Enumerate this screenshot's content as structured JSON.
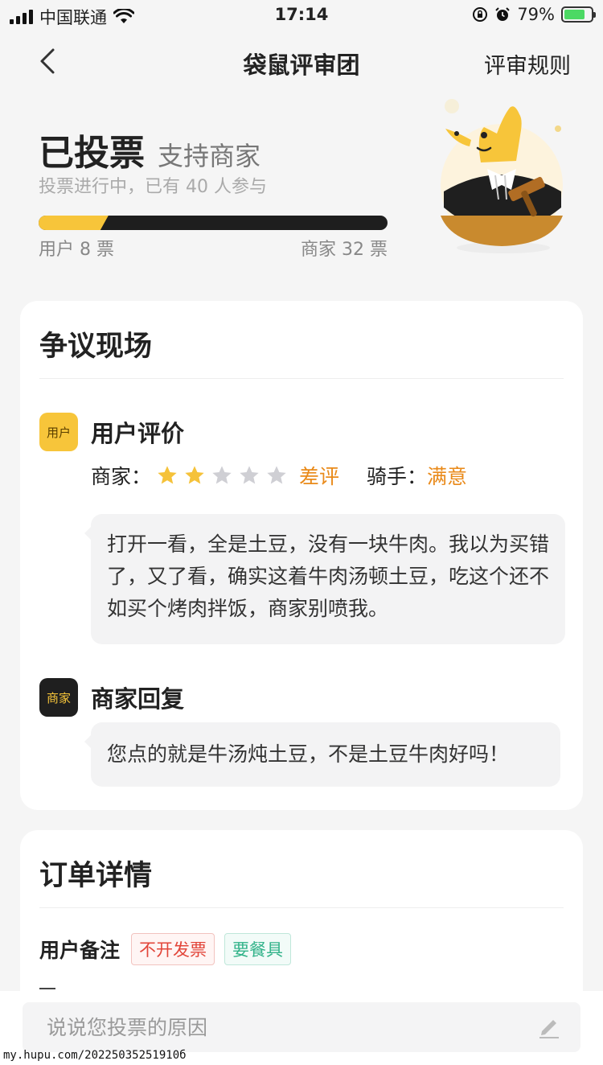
{
  "status_bar": {
    "carrier": "中国联通",
    "time": "17:14",
    "battery_percent": "79%",
    "battery_level": 0.79
  },
  "nav": {
    "title": "袋鼠评审团",
    "rules_link": "评审规则"
  },
  "vote": {
    "status": "已投票",
    "choice": "支持商家",
    "progress_text": "投票进行中，已有 40 人参与",
    "user_votes_label": "用户 8 票",
    "merchant_votes_label": "商家 32 票",
    "user_votes": 8,
    "merchant_votes": 32,
    "colors": {
      "user": "#f7c53a",
      "merchant": "#1e1e1e"
    }
  },
  "dispute": {
    "title": "争议现场",
    "user_badge": "用户",
    "user_review_title": "用户评价",
    "merchant_label": "商家：",
    "merchant_rating": 2,
    "merchant_rating_max": 5,
    "merchant_rating_word": "差评",
    "rider_label": "骑手：",
    "rider_value": "满意",
    "review_text": "打开一看，全是土豆，没有一块牛肉。我以为买错了，又了看，确实这着牛肉汤顿土豆，吃这个还不如买个烤肉拌饭，商家别喷我。",
    "merchant_badge": "商家",
    "merchant_reply_title": "商家回复",
    "reply_text": "您点的就是牛汤炖土豆，不是土豆牛肉好吗！"
  },
  "order": {
    "title": "订单详情",
    "note_label": "用户备注",
    "tags": [
      "不开发票",
      "要餐具"
    ]
  },
  "input": {
    "placeholder": "说说您投票的原因"
  },
  "watermark": "my.hupu.com/20225035251910б"
}
